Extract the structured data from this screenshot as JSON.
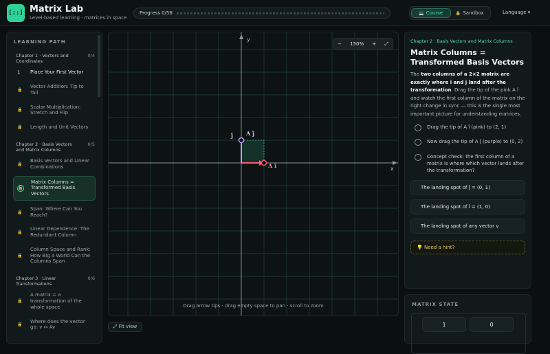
{
  "header": {
    "logo_glyph": "[::]",
    "title": "Matrix Lab",
    "subtitle": "Level-based learning · matrices in space",
    "progress_label": "Progress 0/56",
    "modes": [
      {
        "icon": "💻",
        "label": "Course",
        "active": true
      },
      {
        "icon": "🔒",
        "label": "Sandbox",
        "active": false
      }
    ],
    "language_label": "Language ▾",
    "accent_color": "#54e1ad"
  },
  "sidebar": {
    "heading": "LEARNING PATH",
    "chapters": [
      {
        "title": "Chapter 1 · Vectors and Coordinates",
        "count": "0/4",
        "lessons": [
          {
            "label": "Place Your First Vector",
            "icon": "1",
            "state": "current"
          },
          {
            "label": "Vector Addition: Tip to Tail",
            "icon": "lock",
            "state": "locked"
          },
          {
            "label": "Scalar Multiplication: Stretch and Flip",
            "icon": "lock",
            "state": "locked"
          },
          {
            "label": "Length and Unit Vectors",
            "icon": "lock",
            "state": "locked"
          }
        ]
      },
      {
        "title": "Chapter 2 · Basis Vectors and Matrix Columns",
        "count": "0/5",
        "lessons": [
          {
            "label": "Basis Vectors and Linear Combinations",
            "icon": "lock",
            "state": "locked"
          },
          {
            "label": "Matrix Columns = Transformed Basis Vectors",
            "icon": "lock",
            "state": "selected"
          },
          {
            "label": "Span: Where Can You Reach?",
            "icon": "lock",
            "state": "locked"
          },
          {
            "label": "Linear Dependence: The Redundant Column",
            "icon": "lock",
            "state": "locked"
          },
          {
            "label": "Column Space and Rank: How Big a World Can the Columns Span",
            "icon": "lock",
            "state": "locked"
          }
        ]
      },
      {
        "title": "Chapter 3 · Linear Transformations",
        "count": "0/6",
        "lessons": [
          {
            "label": "A matrix = a transformation of the whole space",
            "icon": "lock",
            "state": "locked"
          },
          {
            "label": "Where does the vector go: v ↦ Av",
            "icon": "lock",
            "state": "locked"
          }
        ]
      }
    ]
  },
  "canvas": {
    "x_axis_label": "x",
    "y_axis_label": "y",
    "zoom": {
      "minus": "−",
      "level": "150%",
      "plus": "+",
      "fullscreen": "⤢"
    },
    "vectors": [
      {
        "name": "A î",
        "end": [
          1,
          0
        ],
        "color": "#ff5a78"
      },
      {
        "name": "A ĵ",
        "end": [
          0,
          1
        ],
        "color": "#c39bff"
      }
    ],
    "basis_label_j": "ĵ",
    "footer_hint": "Drag arrow tips · drag empty space to pan · scroll to zoom",
    "fit_view_label": "⤢ Fit view"
  },
  "lesson_panel": {
    "chapter_label": "Chapter 2 · Basis Vectors and Matrix Columns",
    "title": "Matrix Columns = Transformed Basis Vectors",
    "intro_prefix": "The ",
    "intro_bold": "two columns of a 2×2 matrix are exactly where î and ĵ land after the transformation",
    "intro_suffix": ". Drag the tip of the pink A î and watch the first column of the matrix on the right change in sync — this is the single most important picture for understanding matrices.",
    "tasks": [
      {
        "label": "Drag the tip of A î (pink) to (2, 1)"
      },
      {
        "label": "Now drag the tip of A ĵ (purple) to (0, 2)"
      },
      {
        "label": "Concept check: the first column of a matrix is where which vector lands after the transformation?"
      }
    ],
    "options": [
      {
        "label": "The landing spot of ĵ = (0, 1)"
      },
      {
        "label": "The landing spot of î = (1, 0)"
      },
      {
        "label": "The landing spot of any vector v"
      }
    ],
    "hint_label": "💡 Need a hint?"
  },
  "matrix_state": {
    "heading": "MATRIX STATE",
    "cells": [
      "1",
      "0"
    ]
  }
}
